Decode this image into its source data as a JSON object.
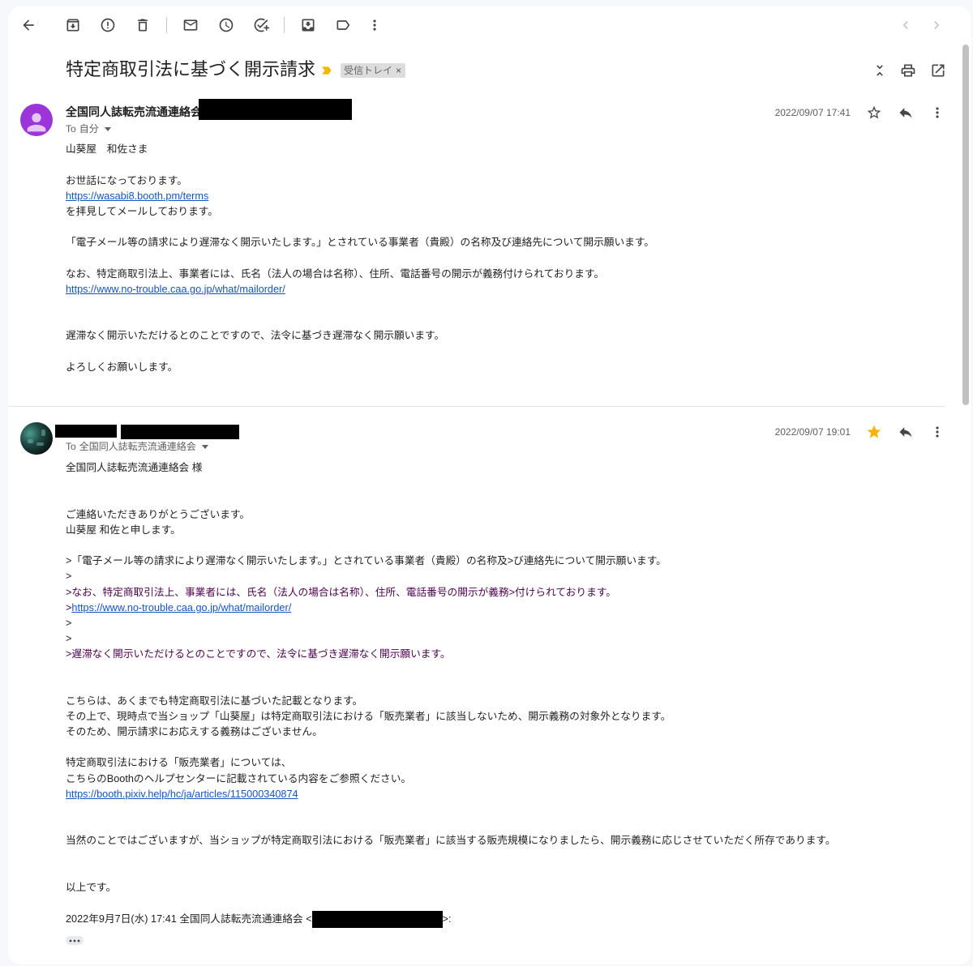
{
  "toolbar": {
    "left_icons": [
      "back-icon",
      "archive-icon",
      "report-spam-icon",
      "delete-icon",
      "mark-unread-icon",
      "snooze-icon",
      "add-to-tasks-icon",
      "move-to-icon",
      "label-icon",
      "more-icon"
    ],
    "right_icons": [
      "newer-chevron-left-icon",
      "older-chevron-right-icon"
    ]
  },
  "thread": {
    "subject": "特定商取引法に基づく開示請求",
    "importance_icon": "importance-marker-icon",
    "label_chip": {
      "text": "受信トレイ",
      "remove": "×"
    },
    "header_icons": [
      "collapse-all-icon",
      "print-icon",
      "open-in-new-window-icon"
    ]
  },
  "colors": {
    "link": "#1155cc",
    "quoted_text": "#500050",
    "star": "#f4b400",
    "importance": "#f2b600",
    "avatar": "#9b34d9"
  },
  "messages": [
    {
      "sender": "全国同人誌転売流通連絡会",
      "to_prefix": "To",
      "to": "自分",
      "date": "2022/09/07 17:41",
      "starred": false,
      "body": [
        {
          "text": "山葵屋　和佐さま"
        },
        null,
        {
          "text": "お世話になっております。"
        },
        {
          "link": "https://wasabi8.booth.pm/terms"
        },
        {
          "text": "を拝見してメールしております。"
        },
        null,
        {
          "text": "「電子メール等の請求により遅滞なく開示いたします。」とされている事業者（貴殿）の名称及び連絡先について開示願います。"
        },
        null,
        {
          "text": "なお、特定商取引法上、事業者には、氏名（法人の場合は名称）、住所、電話番号の開示が義務付けられております。"
        },
        {
          "link": "https://www.no-trouble.caa.go.jp/what/mailorder/"
        },
        null,
        null,
        {
          "text": "遅滞なく開示いただけるとのことですので、法令に基づき遅滞なく開示願います。"
        },
        null,
        {
          "text": "よろしくお願いします。"
        }
      ]
    },
    {
      "to_prefix": "To",
      "to": "全国同人誌転売流通連絡会",
      "date": "2022/09/07 19:01",
      "starred": true,
      "body": [
        {
          "text": "全国同人誌転売流通連絡会 様"
        },
        null,
        null,
        {
          "text": "ご連絡いただきありがとうございます。"
        },
        {
          "text": "山葵屋 和佐と申します。"
        },
        null,
        {
          "prefix": ">",
          "text": "「電子メール等の請求により遅滞なく開示いたします。」とされている事業者（貴殿）の名称及>び連絡先について開示願います。"
        },
        {
          "prefix": ">"
        },
        {
          "prefix": ">",
          "text": "なお、特定商取引法上、事業者には、氏名（法人の場合は名称）、住所、電話番号の開示が義務>付けられております。",
          "color": "#500050"
        },
        {
          "prefix": ">",
          "link": "https://www.no-trouble.caa.go.jp/what/mailorder/",
          "color": "#500050"
        },
        {
          "prefix": ">"
        },
        {
          "prefix": ">"
        },
        {
          "prefix": ">",
          "text": "遅滞なく開示いただけるとのことですので、法令に基づき遅滞なく開示願います。",
          "color": "#500050"
        },
        null,
        null,
        {
          "text": "こちらは、あくまでも特定商取引法に基づいた記載となります。"
        },
        {
          "text": "その上で、現時点で当ショップ「山葵屋」は特定商取引法における「販売業者」に該当しないため、開示義務の対象外となります。"
        },
        {
          "text": "そのため、開示請求にお応えする義務はございません。"
        },
        null,
        {
          "text": "特定商取引法における「販売業者」については、"
        },
        {
          "text": "こちらのBoothのヘルプセンターに記載されている内容をご参照ください。"
        },
        {
          "link": "https://booth.pixiv.help/hc/ja/articles/115000340874"
        },
        null,
        null,
        {
          "text": "当然のことではございますが、当ショップが特定商取引法における「販売業者」に該当する販売規模になりましたら、開示義務に応じさせていただく所存であります。"
        },
        null,
        null,
        {
          "text": "以上です。"
        },
        null,
        {
          "before": "2022年9月7日(水) 17:41 全国同人誌転売流通連絡会 <",
          "after": ">:"
        }
      ]
    }
  ]
}
